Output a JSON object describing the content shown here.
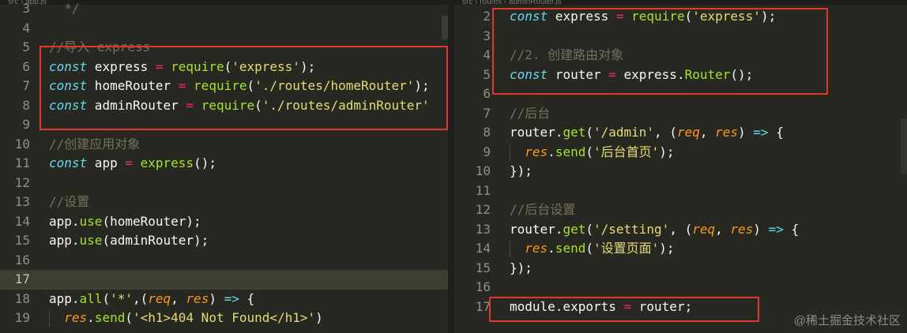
{
  "left_pane": {
    "breadcrumb": "src › app.js",
    "lines": [
      {
        "num": "3",
        "tokens": [
          {
            "t": "  */",
            "c": "c"
          }
        ]
      },
      {
        "num": "4",
        "tokens": []
      },
      {
        "num": "5",
        "tokens": [
          {
            "t": "//导入 express",
            "c": "c"
          }
        ]
      },
      {
        "num": "6",
        "tokens": [
          {
            "t": "const",
            "c": "k"
          },
          {
            "t": " express ",
            "c": "w"
          },
          {
            "t": "=",
            "c": "op"
          },
          {
            "t": " ",
            "c": "w"
          },
          {
            "t": "require",
            "c": "fn"
          },
          {
            "t": "(",
            "c": "w"
          },
          {
            "t": "'express'",
            "c": "s"
          },
          {
            "t": ");",
            "c": "w"
          }
        ]
      },
      {
        "num": "7",
        "tokens": [
          {
            "t": "const",
            "c": "k"
          },
          {
            "t": " homeRouter ",
            "c": "w"
          },
          {
            "t": "=",
            "c": "op"
          },
          {
            "t": " ",
            "c": "w"
          },
          {
            "t": "require",
            "c": "fn"
          },
          {
            "t": "(",
            "c": "w"
          },
          {
            "t": "'./routes/homeRouter'",
            "c": "s"
          },
          {
            "t": ");",
            "c": "w"
          }
        ]
      },
      {
        "num": "8",
        "tokens": [
          {
            "t": "const",
            "c": "k"
          },
          {
            "t": " adminRouter ",
            "c": "w"
          },
          {
            "t": "=",
            "c": "op"
          },
          {
            "t": " ",
            "c": "w"
          },
          {
            "t": "require",
            "c": "fn"
          },
          {
            "t": "(",
            "c": "w"
          },
          {
            "t": "'./routes/adminRouter'",
            "c": "s"
          }
        ]
      },
      {
        "num": "9",
        "tokens": []
      },
      {
        "num": "10",
        "tokens": [
          {
            "t": "//创建应用对象",
            "c": "c"
          }
        ]
      },
      {
        "num": "11",
        "tokens": [
          {
            "t": "const",
            "c": "k"
          },
          {
            "t": " app ",
            "c": "w"
          },
          {
            "t": "=",
            "c": "op"
          },
          {
            "t": " ",
            "c": "w"
          },
          {
            "t": "express",
            "c": "fn"
          },
          {
            "t": "();",
            "c": "w"
          }
        ]
      },
      {
        "num": "12",
        "tokens": []
      },
      {
        "num": "13",
        "tokens": [
          {
            "t": "//设置",
            "c": "c"
          }
        ]
      },
      {
        "num": "14",
        "tokens": [
          {
            "t": "app.",
            "c": "w"
          },
          {
            "t": "use",
            "c": "fn"
          },
          {
            "t": "(homeRouter);",
            "c": "w"
          }
        ]
      },
      {
        "num": "15",
        "tokens": [
          {
            "t": "app.",
            "c": "w"
          },
          {
            "t": "use",
            "c": "fn"
          },
          {
            "t": "(adminRouter);",
            "c": "w"
          }
        ]
      },
      {
        "num": "16",
        "tokens": []
      },
      {
        "num": "17",
        "tokens": [],
        "active": true
      },
      {
        "num": "18",
        "tokens": [
          {
            "t": "app.",
            "c": "w"
          },
          {
            "t": "all",
            "c": "fn"
          },
          {
            "t": "(",
            "c": "w"
          },
          {
            "t": "'*'",
            "c": "s"
          },
          {
            "t": ",(",
            "c": "w"
          },
          {
            "t": "req",
            "c": "p"
          },
          {
            "t": ", ",
            "c": "w"
          },
          {
            "t": "res",
            "c": "p"
          },
          {
            "t": ") ",
            "c": "w"
          },
          {
            "t": "=>",
            "c": "k"
          },
          {
            "t": " {",
            "c": "w"
          }
        ]
      },
      {
        "num": "19",
        "indent": true,
        "tokens": [
          {
            "t": "  ",
            "c": "w"
          },
          {
            "t": "res",
            "c": "p"
          },
          {
            "t": ".",
            "c": "w"
          },
          {
            "t": "send",
            "c": "fn"
          },
          {
            "t": "(",
            "c": "w"
          },
          {
            "t": "'<h1>404 Not Found</h1>'",
            "c": "s"
          },
          {
            "t": ")",
            "c": "w"
          }
        ]
      }
    ]
  },
  "right_pane": {
    "breadcrumb": "src › routes › adminRouter.js",
    "lines": [
      {
        "num": "2",
        "tokens": [
          {
            "t": "const",
            "c": "k"
          },
          {
            "t": " express ",
            "c": "w"
          },
          {
            "t": "=",
            "c": "op"
          },
          {
            "t": " ",
            "c": "w"
          },
          {
            "t": "require",
            "c": "fn"
          },
          {
            "t": "(",
            "c": "w"
          },
          {
            "t": "'express'",
            "c": "s"
          },
          {
            "t": ");",
            "c": "w"
          }
        ]
      },
      {
        "num": "3",
        "tokens": []
      },
      {
        "num": "4",
        "tokens": [
          {
            "t": "//2. 创建路由对象",
            "c": "c"
          }
        ]
      },
      {
        "num": "5",
        "tokens": [
          {
            "t": "const",
            "c": "k"
          },
          {
            "t": " router ",
            "c": "w"
          },
          {
            "t": "=",
            "c": "op"
          },
          {
            "t": " express.",
            "c": "w"
          },
          {
            "t": "Router",
            "c": "fn"
          },
          {
            "t": "();",
            "c": "w"
          }
        ]
      },
      {
        "num": "6",
        "tokens": []
      },
      {
        "num": "7",
        "tokens": [
          {
            "t": "//后台",
            "c": "c"
          }
        ]
      },
      {
        "num": "8",
        "tokens": [
          {
            "t": "router.",
            "c": "w"
          },
          {
            "t": "get",
            "c": "fn"
          },
          {
            "t": "(",
            "c": "w"
          },
          {
            "t": "'/admin'",
            "c": "s"
          },
          {
            "t": ", (",
            "c": "w"
          },
          {
            "t": "req",
            "c": "p"
          },
          {
            "t": ", ",
            "c": "w"
          },
          {
            "t": "res",
            "c": "p"
          },
          {
            "t": ") ",
            "c": "w"
          },
          {
            "t": "=>",
            "c": "k"
          },
          {
            "t": " {",
            "c": "w"
          }
        ]
      },
      {
        "num": "9",
        "indent": true,
        "tokens": [
          {
            "t": "  ",
            "c": "w"
          },
          {
            "t": "res",
            "c": "p"
          },
          {
            "t": ".",
            "c": "w"
          },
          {
            "t": "send",
            "c": "fn"
          },
          {
            "t": "(",
            "c": "w"
          },
          {
            "t": "'后台首页'",
            "c": "s"
          },
          {
            "t": ");",
            "c": "w"
          }
        ]
      },
      {
        "num": "10",
        "tokens": [
          {
            "t": "});",
            "c": "w"
          }
        ]
      },
      {
        "num": "11",
        "tokens": []
      },
      {
        "num": "12",
        "tokens": [
          {
            "t": "//后台设置",
            "c": "c"
          }
        ]
      },
      {
        "num": "13",
        "tokens": [
          {
            "t": "router.",
            "c": "w"
          },
          {
            "t": "get",
            "c": "fn"
          },
          {
            "t": "(",
            "c": "w"
          },
          {
            "t": "'/setting'",
            "c": "s"
          },
          {
            "t": ", (",
            "c": "w"
          },
          {
            "t": "req",
            "c": "p"
          },
          {
            "t": ", ",
            "c": "w"
          },
          {
            "t": "res",
            "c": "p"
          },
          {
            "t": ") ",
            "c": "w"
          },
          {
            "t": "=>",
            "c": "k"
          },
          {
            "t": " {",
            "c": "w"
          }
        ]
      },
      {
        "num": "14",
        "indent": true,
        "tokens": [
          {
            "t": "  ",
            "c": "w"
          },
          {
            "t": "res",
            "c": "p"
          },
          {
            "t": ".",
            "c": "w"
          },
          {
            "t": "send",
            "c": "fn"
          },
          {
            "t": "(",
            "c": "w"
          },
          {
            "t": "'设置页面'",
            "c": "s"
          },
          {
            "t": ");",
            "c": "w"
          }
        ]
      },
      {
        "num": "15",
        "tokens": [
          {
            "t": "});",
            "c": "w"
          }
        ]
      },
      {
        "num": "16",
        "tokens": []
      },
      {
        "num": "17",
        "tokens": [
          {
            "t": "module.exports ",
            "c": "w"
          },
          {
            "t": "=",
            "c": "op"
          },
          {
            "t": " router;",
            "c": "w"
          }
        ]
      }
    ]
  },
  "highlight_color": "#e2352b",
  "watermark": "@稀土掘金技术社区"
}
